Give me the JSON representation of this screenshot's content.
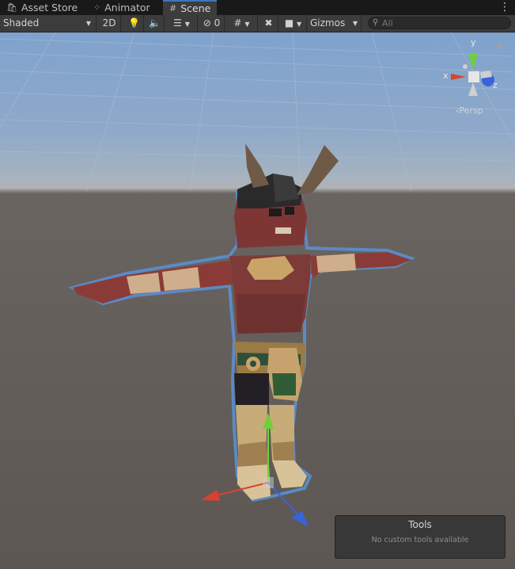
{
  "tabs": [
    {
      "label": "Asset Store",
      "icon": "shopping-bag-icon"
    },
    {
      "label": "Animator",
      "icon": "animator-icon"
    },
    {
      "label": "Scene",
      "icon": "grid-icon"
    }
  ],
  "toolbar": {
    "shading_mode": "Shaded",
    "two_d_label": "2D",
    "hidden_count": "0",
    "gizmos_label": "Gizmos",
    "search_placeholder": "All"
  },
  "scene": {
    "projection_label": "Persp",
    "axis_x": "x",
    "axis_y": "y",
    "axis_z": "z"
  },
  "tools_overlay": {
    "title": "Tools",
    "message": "No custom tools available"
  },
  "colors": {
    "selection_outline": "#5a8fd0",
    "axis_x": "#d8432f",
    "axis_y": "#6fcf3a",
    "axis_z": "#3a63d8",
    "active_tab": "#3a79bb"
  }
}
